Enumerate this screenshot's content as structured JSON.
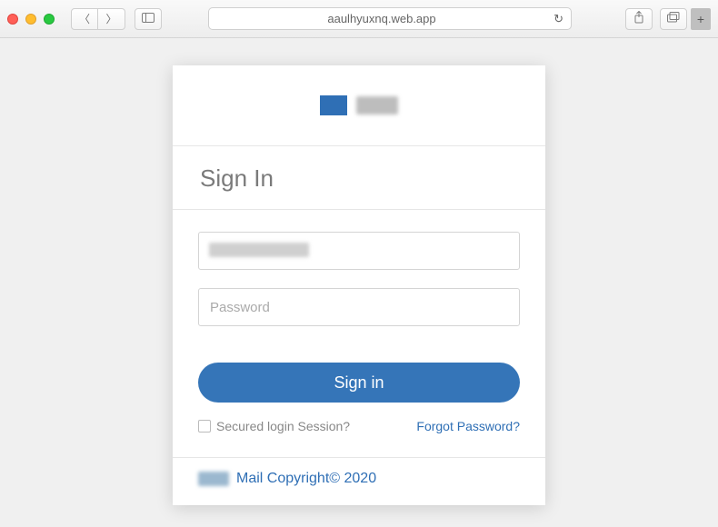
{
  "browser": {
    "url": "aaulhyuxnq.web.app"
  },
  "login": {
    "heading": "Sign In",
    "email_value": "",
    "password_placeholder": "Password",
    "submit_label": "Sign in",
    "secured_label": "Secured login Session?",
    "forgot_label": "Forgot Password?",
    "footer_text": "Mail Copyright© 2020"
  }
}
